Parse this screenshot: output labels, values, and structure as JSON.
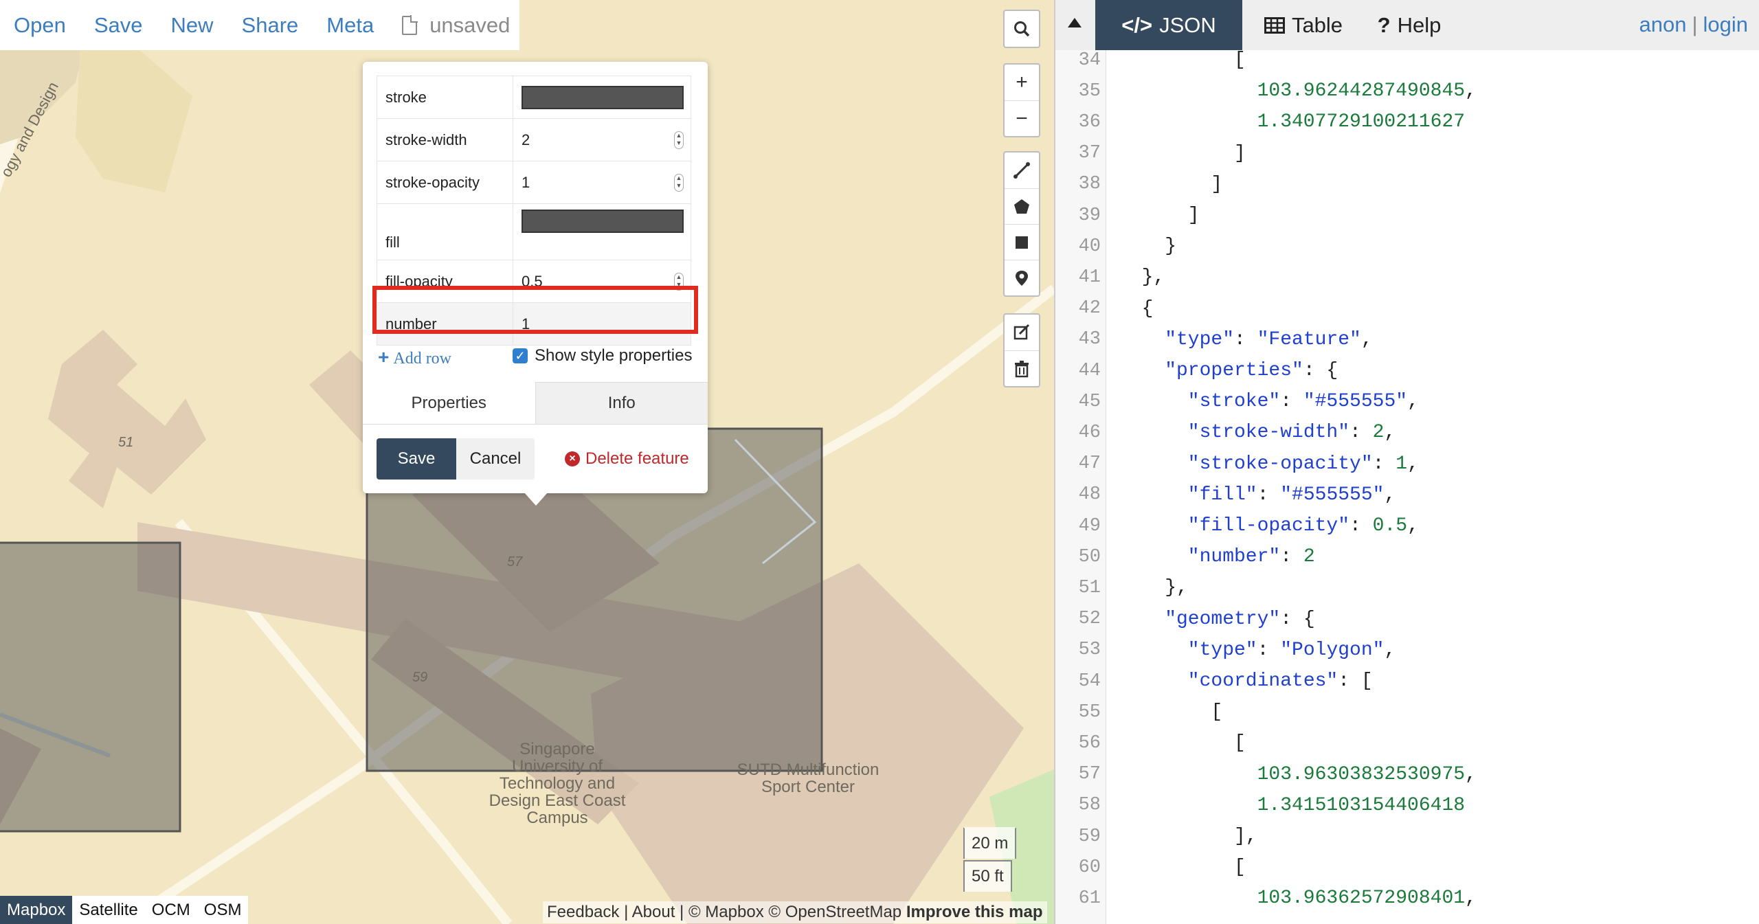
{
  "toolbar": {
    "open": "Open",
    "save": "Save",
    "new": "New",
    "share": "Share",
    "meta": "Meta",
    "status": "unsaved"
  },
  "map_controls": {
    "search": "search-icon",
    "zoom_in": "+",
    "zoom_out": "−",
    "draw_tools": [
      "line-icon",
      "polygon-icon",
      "rectangle-icon",
      "marker-icon"
    ],
    "edit_tools": [
      "edit-icon",
      "trash-icon"
    ]
  },
  "popup": {
    "rows": [
      {
        "key": "stroke",
        "type": "color",
        "value": "#555555"
      },
      {
        "key": "stroke-width",
        "type": "number",
        "value": "2"
      },
      {
        "key": "stroke-opacity",
        "type": "number",
        "value": "1"
      },
      {
        "key": "fill",
        "type": "color",
        "value": "#555555"
      },
      {
        "key": "fill-opacity",
        "type": "number",
        "value": "0.5"
      },
      {
        "key": "number",
        "type": "text",
        "value": "1"
      }
    ],
    "add_row": "Add row",
    "show_style": "Show style properties",
    "show_style_checked": true,
    "tabs": [
      "Properties",
      "Info"
    ],
    "save": "Save",
    "cancel": "Cancel",
    "delete": "Delete feature"
  },
  "map_labels": {
    "campus": [
      "Singapore",
      "University of",
      "Technology and",
      "Design East Coast",
      "Campus"
    ],
    "sport": [
      "SUTD Multifunction",
      "Sport Center"
    ],
    "road": "ogy and Design",
    "bldg51": "51",
    "bldg57": "57",
    "bldg59": "59"
  },
  "scale": {
    "metric": "20 m",
    "imperial": "50 ft"
  },
  "base_layers": [
    {
      "label": "Mapbox",
      "active": true
    },
    {
      "label": "Satellite",
      "active": false
    },
    {
      "label": "OCM",
      "active": false
    },
    {
      "label": "OSM",
      "active": false
    }
  ],
  "attribution": {
    "feedback": "Feedback",
    "about": "About",
    "mapbox": "© Mapbox",
    "osm": "© OpenStreetMap",
    "improve": "Improve this map"
  },
  "pane": {
    "tabs": {
      "json": "JSON",
      "table": "Table",
      "help": "Help"
    },
    "user": "anon",
    "login": "login"
  },
  "code_lines": [
    {
      "n": "34",
      "indent": 10,
      "parts": [
        [
          "p",
          "["
        ]
      ]
    },
    {
      "n": "35",
      "indent": 12,
      "parts": [
        [
          "num",
          "103.96244287490845"
        ],
        [
          "p",
          ","
        ]
      ]
    },
    {
      "n": "36",
      "indent": 12,
      "parts": [
        [
          "num",
          "1.3407729100211627"
        ]
      ]
    },
    {
      "n": "37",
      "indent": 10,
      "parts": [
        [
          "p",
          "]"
        ]
      ]
    },
    {
      "n": "38",
      "indent": 8,
      "parts": [
        [
          "p",
          "]"
        ]
      ]
    },
    {
      "n": "39",
      "indent": 6,
      "parts": [
        [
          "p",
          "]"
        ]
      ]
    },
    {
      "n": "40",
      "indent": 4,
      "parts": [
        [
          "p",
          "}"
        ]
      ]
    },
    {
      "n": "41",
      "indent": 2,
      "parts": [
        [
          "p",
          "},"
        ]
      ]
    },
    {
      "n": "42",
      "indent": 2,
      "parts": [
        [
          "p",
          "{"
        ]
      ]
    },
    {
      "n": "43",
      "indent": 4,
      "parts": [
        [
          "key",
          "\"type\""
        ],
        [
          "p",
          ": "
        ],
        [
          "str",
          "\"Feature\""
        ],
        [
          "p",
          ","
        ]
      ]
    },
    {
      "n": "44",
      "indent": 4,
      "parts": [
        [
          "key",
          "\"properties\""
        ],
        [
          "p",
          ": {"
        ]
      ]
    },
    {
      "n": "45",
      "indent": 6,
      "parts": [
        [
          "key",
          "\"stroke\""
        ],
        [
          "p",
          ": "
        ],
        [
          "str",
          "\"#555555\""
        ],
        [
          "p",
          ","
        ]
      ]
    },
    {
      "n": "46",
      "indent": 6,
      "parts": [
        [
          "key",
          "\"stroke-width\""
        ],
        [
          "p",
          ": "
        ],
        [
          "num",
          "2"
        ],
        [
          "p",
          ","
        ]
      ]
    },
    {
      "n": "47",
      "indent": 6,
      "parts": [
        [
          "key",
          "\"stroke-opacity\""
        ],
        [
          "p",
          ": "
        ],
        [
          "num",
          "1"
        ],
        [
          "p",
          ","
        ]
      ]
    },
    {
      "n": "48",
      "indent": 6,
      "parts": [
        [
          "key",
          "\"fill\""
        ],
        [
          "p",
          ": "
        ],
        [
          "str",
          "\"#555555\""
        ],
        [
          "p",
          ","
        ]
      ]
    },
    {
      "n": "49",
      "indent": 6,
      "parts": [
        [
          "key",
          "\"fill-opacity\""
        ],
        [
          "p",
          ": "
        ],
        [
          "num",
          "0.5"
        ],
        [
          "p",
          ","
        ]
      ]
    },
    {
      "n": "50",
      "indent": 6,
      "parts": [
        [
          "key",
          "\"number\""
        ],
        [
          "p",
          ": "
        ],
        [
          "num",
          "2"
        ]
      ]
    },
    {
      "n": "51",
      "indent": 4,
      "parts": [
        [
          "p",
          "},"
        ]
      ]
    },
    {
      "n": "52",
      "indent": 4,
      "parts": [
        [
          "key",
          "\"geometry\""
        ],
        [
          "p",
          ": {"
        ]
      ]
    },
    {
      "n": "53",
      "indent": 6,
      "parts": [
        [
          "key",
          "\"type\""
        ],
        [
          "p",
          ": "
        ],
        [
          "str",
          "\"Polygon\""
        ],
        [
          "p",
          ","
        ]
      ]
    },
    {
      "n": "54",
      "indent": 6,
      "parts": [
        [
          "key",
          "\"coordinates\""
        ],
        [
          "p",
          ": ["
        ]
      ]
    },
    {
      "n": "55",
      "indent": 8,
      "parts": [
        [
          "p",
          "["
        ]
      ]
    },
    {
      "n": "56",
      "indent": 10,
      "parts": [
        [
          "p",
          "["
        ]
      ]
    },
    {
      "n": "57",
      "indent": 12,
      "parts": [
        [
          "num",
          "103.96303832530975"
        ],
        [
          "p",
          ","
        ]
      ]
    },
    {
      "n": "58",
      "indent": 12,
      "parts": [
        [
          "num",
          "1.3415103154406418"
        ]
      ]
    },
    {
      "n": "59",
      "indent": 10,
      "parts": [
        [
          "p",
          "],"
        ]
      ]
    },
    {
      "n": "60",
      "indent": 10,
      "parts": [
        [
          "p",
          "["
        ]
      ]
    },
    {
      "n": "61",
      "indent": 12,
      "parts": [
        [
          "num",
          "103.96362572908401"
        ],
        [
          "p",
          ","
        ]
      ]
    }
  ],
  "colors": {
    "accent": "#34495e",
    "link": "#3c7dbf",
    "highlight": "#e02b20",
    "feature_fill": "#555555",
    "map_bg": "#f2e6c3"
  }
}
